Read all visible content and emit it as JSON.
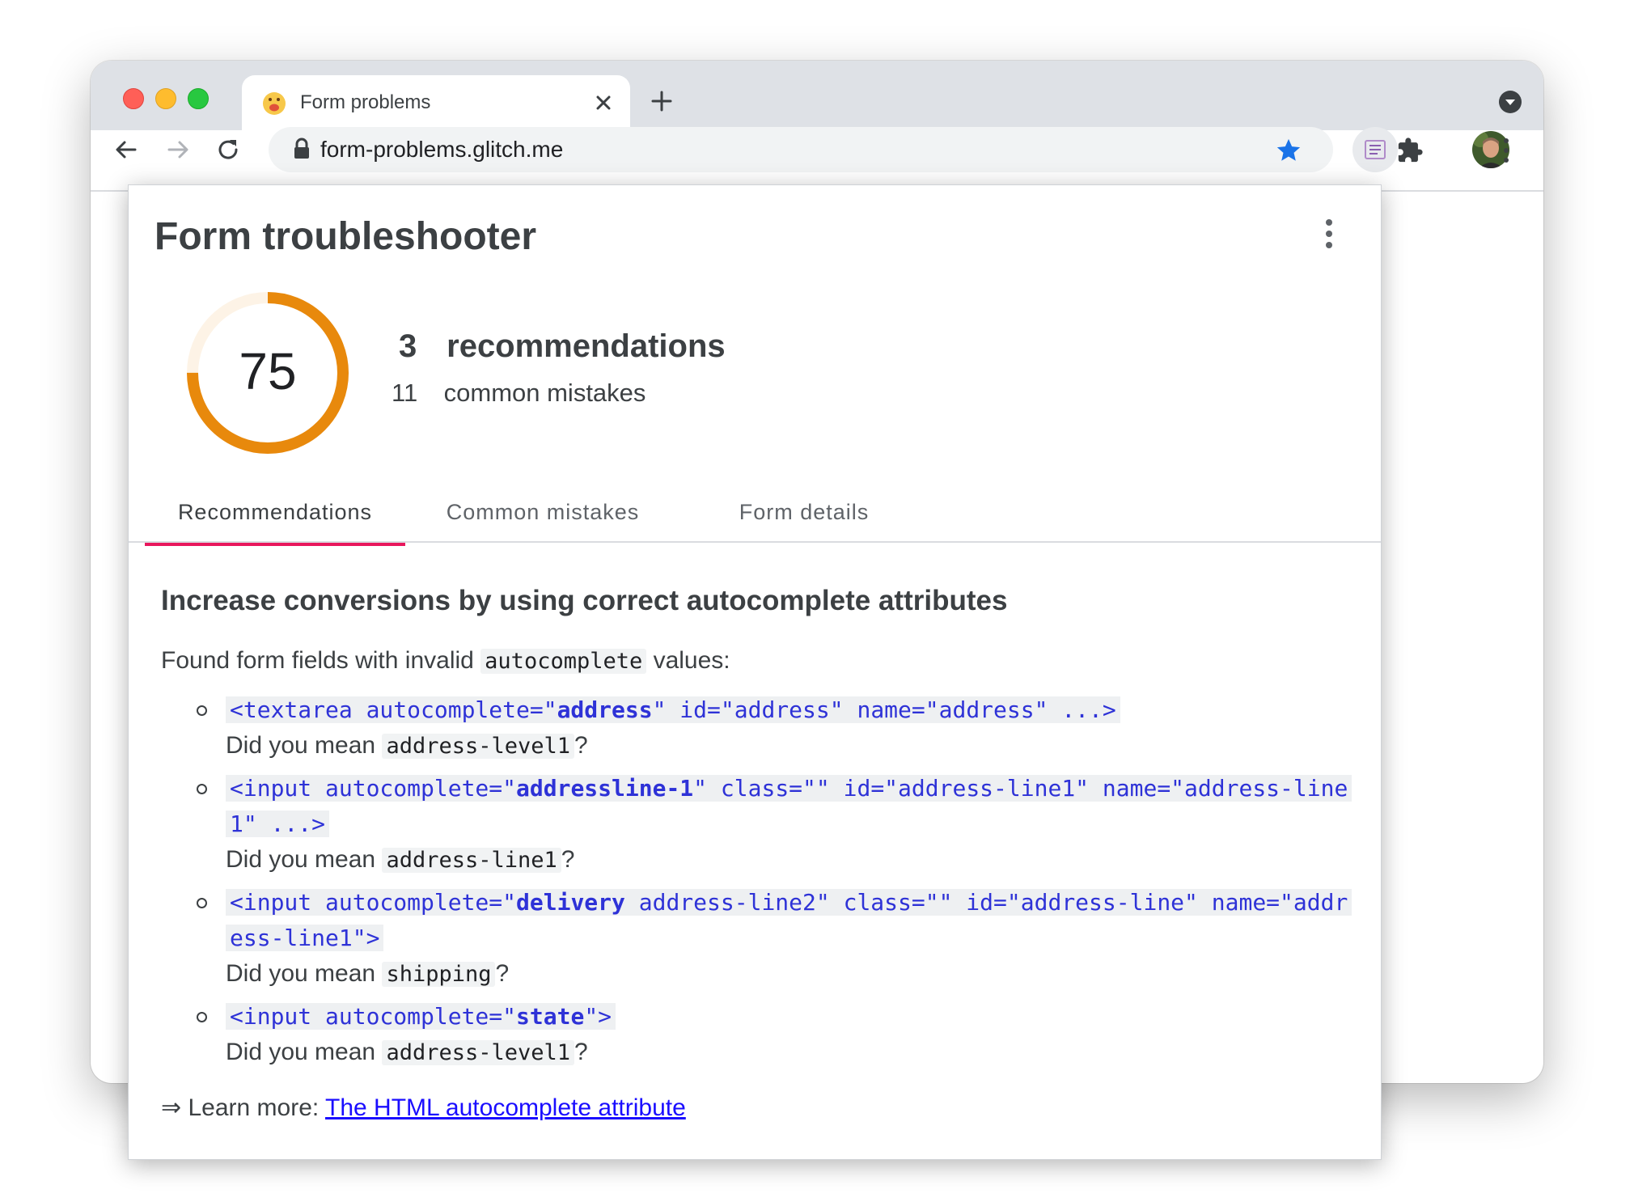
{
  "browser": {
    "tab_title": "Form problems",
    "url": "form-problems.glitch.me",
    "colors": {
      "close": "#ff5f57",
      "minimize": "#febc2e",
      "zoom": "#28c840",
      "star": "#1a73e8"
    }
  },
  "popup": {
    "title": "Form troubleshooter",
    "score": "75",
    "score_value": 75,
    "score_color": "#e8890c",
    "recommendations_count": "3",
    "recommendations_label": "recommendations",
    "mistakes_count": "11",
    "mistakes_label": "common mistakes",
    "tabs": [
      "Recommendations",
      "Common mistakes",
      "Form details"
    ],
    "active_tab": "Recommendations",
    "accent": "#e8175d"
  },
  "content": {
    "heading": "Increase conversions by using correct autocomplete attributes",
    "intro_before": "Found form fields with invalid ",
    "intro_code": "autocomplete",
    "intro_after": " values:",
    "items": [
      {
        "pre": "<textarea autocomplete=\"",
        "value": "address",
        "post": "\" id=\"address\" name=\"address\" ...>",
        "did_you_mean": "Did you mean ",
        "suggestion": "address-level1",
        "qmark": "?"
      },
      {
        "pre": "<input autocomplete=\"",
        "value": "addressline-1",
        "post": "\" class=\"\" id=\"address-line1\" name=\"address-line1\" ...>",
        "did_you_mean": "Did you mean ",
        "suggestion": "address-line1",
        "qmark": "?"
      },
      {
        "pre": "<input autocomplete=\"",
        "value": "delivery",
        "post": " address-line2\" class=\"\" id=\"address-line\" name=\"address-line1\">",
        "did_you_mean": "Did you mean ",
        "suggestion": "shipping",
        "qmark": "?"
      },
      {
        "pre": "<input autocomplete=\"",
        "value": "state",
        "post": "\">",
        "did_you_mean": "Did you mean ",
        "suggestion": "address-level1",
        "qmark": "?"
      }
    ],
    "learn_more_prefix": "⇒ Learn more: ",
    "learn_more_link": "The HTML autocomplete attribute"
  }
}
